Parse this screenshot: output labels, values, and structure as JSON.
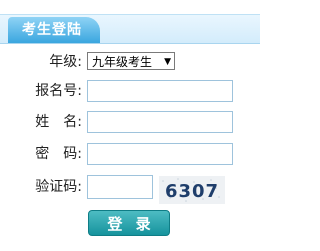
{
  "header": {
    "title": "考生登陆"
  },
  "form": {
    "grade": {
      "label": "年级:",
      "selected": "九年级考生"
    },
    "exam_number": {
      "label": "报名号:",
      "value": ""
    },
    "name": {
      "label": "姓　名:",
      "value": ""
    },
    "password": {
      "label": "密　码:",
      "value": ""
    },
    "captcha": {
      "label": "验证码:",
      "value": "",
      "image_text": "6307"
    }
  },
  "login_button": {
    "label": "登 录"
  },
  "icons": {
    "dropdown_arrow": "▼"
  },
  "colors": {
    "header_tab": "#3aa6df",
    "login_button": "#16939d"
  }
}
